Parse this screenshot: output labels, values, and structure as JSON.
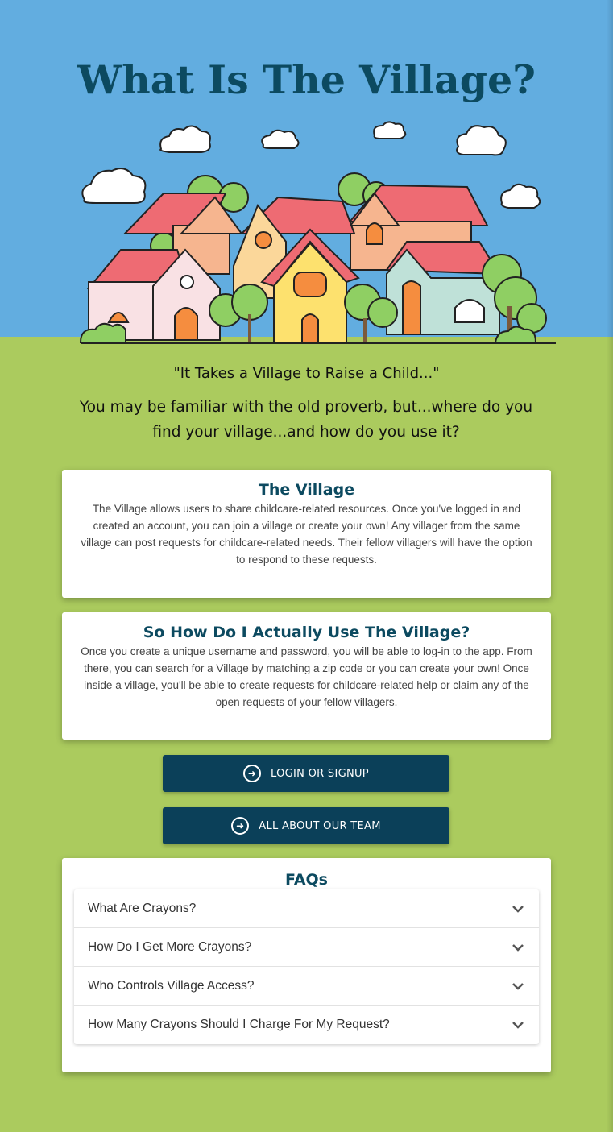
{
  "hero": {
    "title": "What Is The Village?"
  },
  "quote": "\"It Takes a Village to Raise a Child...\"",
  "intro": "You may be familiar with the old proverb, but...where do you find your village...and how do you use it?",
  "cards": [
    {
      "title": "The Village",
      "body": "The Village allows users to share childcare-related resources. Once you've logged in and created an account, you can join a village or create your own! Any villager from the same village can post requests for childcare-related needs. Their fellow villagers will have the option to respond to these requests."
    },
    {
      "title": "So How Do I Actually Use The Village?",
      "body": "Once you create a unique username and password, you will be able to log-in to the app. From there, you can search for a Village by matching a zip code or you can create your own! Once inside a village, you'll be able to create requests for childcare-related help or claim any of the open requests of your fellow villagers."
    }
  ],
  "buttons": {
    "login": "LOGIN OR SIGNUP",
    "team": "ALL ABOUT OUR TEAM",
    "icon": "arrow-circle-right-icon"
  },
  "faq": {
    "title": "FAQs",
    "items": [
      "What Are Crayons?",
      "How Do I Get More Crayons?",
      "Who Controls Village Access?",
      "How Many Crayons Should I Charge For My Request?"
    ]
  },
  "colors": {
    "sky": "#62ade0",
    "grass": "#abcb5e",
    "navy": "#0b4059",
    "title": "#0c4a60"
  }
}
